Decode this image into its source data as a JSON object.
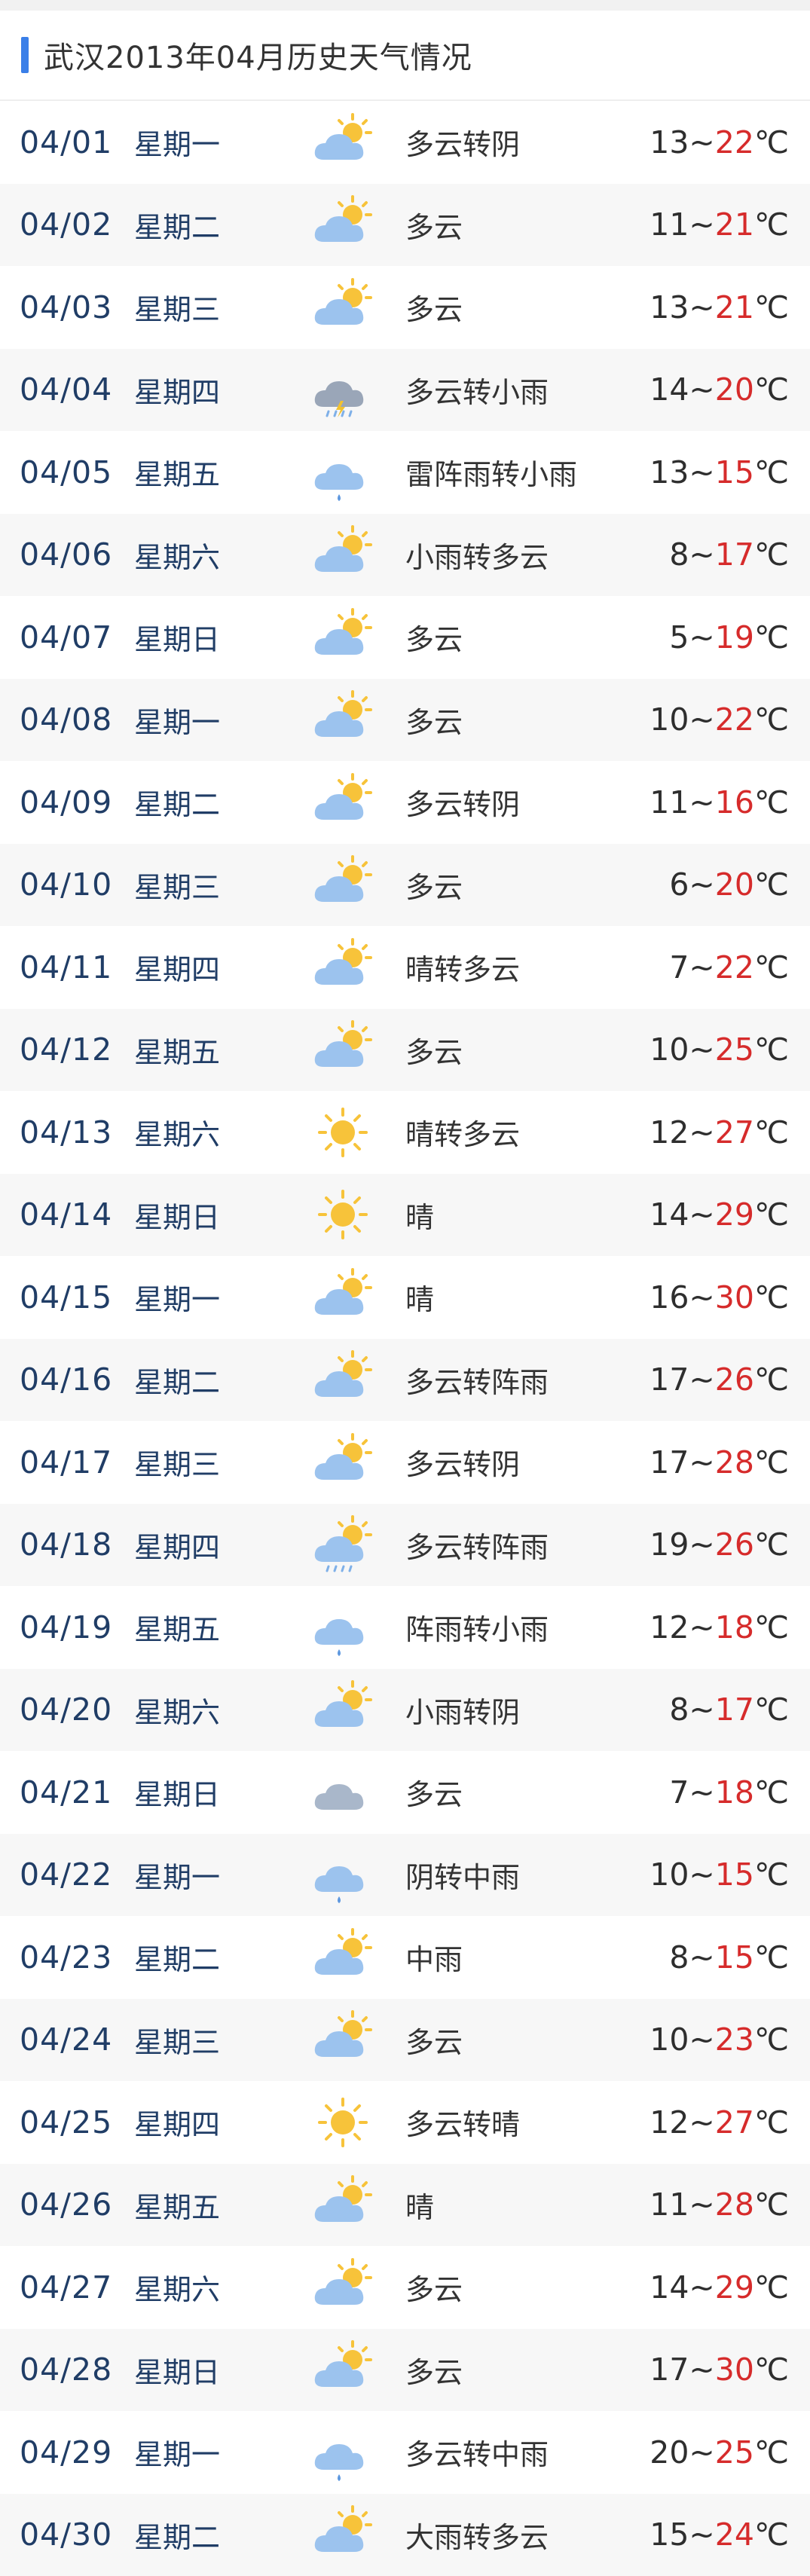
{
  "header": {
    "title": "武汉2013年04月历史天气情况"
  },
  "colors": {
    "accent": "#3a7fe8",
    "high_temp": "#d62b2b",
    "text": "#203d66",
    "row_alt_bg": "#f7f7f7"
  },
  "days": [
    {
      "date": "04/01",
      "weekday": "星期一",
      "icon": "partly-cloudy-icon",
      "weather": "多云转阴",
      "low": "13",
      "high": "22",
      "unit": "℃"
    },
    {
      "date": "04/02",
      "weekday": "星期二",
      "icon": "partly-cloudy-icon",
      "weather": "多云",
      "low": "11",
      "high": "21",
      "unit": "℃"
    },
    {
      "date": "04/03",
      "weekday": "星期三",
      "icon": "partly-cloudy-icon",
      "weather": "多云",
      "low": "13",
      "high": "21",
      "unit": "℃"
    },
    {
      "date": "04/04",
      "weekday": "星期四",
      "icon": "thunder-rain-icon",
      "weather": "多云转小雨",
      "low": "14",
      "high": "20",
      "unit": "℃"
    },
    {
      "date": "04/05",
      "weekday": "星期五",
      "icon": "rain-cloud-icon",
      "weather": "雷阵雨转小雨",
      "low": "13",
      "high": "15",
      "unit": "℃"
    },
    {
      "date": "04/06",
      "weekday": "星期六",
      "icon": "partly-cloudy-icon",
      "weather": "小雨转多云",
      "low": "8",
      "high": "17",
      "unit": "℃"
    },
    {
      "date": "04/07",
      "weekday": "星期日",
      "icon": "partly-cloudy-icon",
      "weather": "多云",
      "low": "5",
      "high": "19",
      "unit": "℃"
    },
    {
      "date": "04/08",
      "weekday": "星期一",
      "icon": "partly-cloudy-icon",
      "weather": "多云",
      "low": "10",
      "high": "22",
      "unit": "℃"
    },
    {
      "date": "04/09",
      "weekday": "星期二",
      "icon": "partly-cloudy-icon",
      "weather": "多云转阴",
      "low": "11",
      "high": "16",
      "unit": "℃"
    },
    {
      "date": "04/10",
      "weekday": "星期三",
      "icon": "partly-cloudy-icon",
      "weather": "多云",
      "low": "6",
      "high": "20",
      "unit": "℃"
    },
    {
      "date": "04/11",
      "weekday": "星期四",
      "icon": "partly-cloudy-icon",
      "weather": "晴转多云",
      "low": "7",
      "high": "22",
      "unit": "℃"
    },
    {
      "date": "04/12",
      "weekday": "星期五",
      "icon": "partly-cloudy-icon",
      "weather": "多云",
      "low": "10",
      "high": "25",
      "unit": "℃"
    },
    {
      "date": "04/13",
      "weekday": "星期六",
      "icon": "sun-icon",
      "weather": "晴转多云",
      "low": "12",
      "high": "27",
      "unit": "℃"
    },
    {
      "date": "04/14",
      "weekday": "星期日",
      "icon": "sun-icon",
      "weather": "晴",
      "low": "14",
      "high": "29",
      "unit": "℃"
    },
    {
      "date": "04/15",
      "weekday": "星期一",
      "icon": "partly-cloudy-icon",
      "weather": "晴",
      "low": "16",
      "high": "30",
      "unit": "℃"
    },
    {
      "date": "04/16",
      "weekday": "星期二",
      "icon": "partly-cloudy-icon",
      "weather": "多云转阵雨",
      "low": "17",
      "high": "26",
      "unit": "℃"
    },
    {
      "date": "04/17",
      "weekday": "星期三",
      "icon": "partly-cloudy-icon",
      "weather": "多云转阴",
      "low": "17",
      "high": "28",
      "unit": "℃"
    },
    {
      "date": "04/18",
      "weekday": "星期四",
      "icon": "sun-rain-icon",
      "weather": "多云转阵雨",
      "low": "19",
      "high": "26",
      "unit": "℃"
    },
    {
      "date": "04/19",
      "weekday": "星期五",
      "icon": "rain-cloud-icon",
      "weather": "阵雨转小雨",
      "low": "12",
      "high": "18",
      "unit": "℃"
    },
    {
      "date": "04/20",
      "weekday": "星期六",
      "icon": "partly-cloudy-icon",
      "weather": "小雨转阴",
      "low": "8",
      "high": "17",
      "unit": "℃"
    },
    {
      "date": "04/21",
      "weekday": "星期日",
      "icon": "cloud-icon",
      "weather": "多云",
      "low": "7",
      "high": "18",
      "unit": "℃"
    },
    {
      "date": "04/22",
      "weekday": "星期一",
      "icon": "rain-cloud-icon",
      "weather": "阴转中雨",
      "low": "10",
      "high": "15",
      "unit": "℃"
    },
    {
      "date": "04/23",
      "weekday": "星期二",
      "icon": "partly-cloudy-icon",
      "weather": "中雨",
      "low": "8",
      "high": "15",
      "unit": "℃"
    },
    {
      "date": "04/24",
      "weekday": "星期三",
      "icon": "partly-cloudy-icon",
      "weather": "多云",
      "low": "10",
      "high": "23",
      "unit": "℃"
    },
    {
      "date": "04/25",
      "weekday": "星期四",
      "icon": "sun-icon",
      "weather": "多云转晴",
      "low": "12",
      "high": "27",
      "unit": "℃"
    },
    {
      "date": "04/26",
      "weekday": "星期五",
      "icon": "partly-cloudy-icon",
      "weather": "晴",
      "low": "11",
      "high": "28",
      "unit": "℃"
    },
    {
      "date": "04/27",
      "weekday": "星期六",
      "icon": "partly-cloudy-icon",
      "weather": "多云",
      "low": "14",
      "high": "29",
      "unit": "℃"
    },
    {
      "date": "04/28",
      "weekday": "星期日",
      "icon": "partly-cloudy-icon",
      "weather": "多云",
      "low": "17",
      "high": "30",
      "unit": "℃"
    },
    {
      "date": "04/29",
      "weekday": "星期一",
      "icon": "rain-cloud-icon",
      "weather": "多云转中雨",
      "low": "20",
      "high": "25",
      "unit": "℃"
    },
    {
      "date": "04/30",
      "weekday": "星期二",
      "icon": "partly-cloudy-icon",
      "weather": "大雨转多云",
      "low": "15",
      "high": "24",
      "unit": "℃"
    }
  ]
}
